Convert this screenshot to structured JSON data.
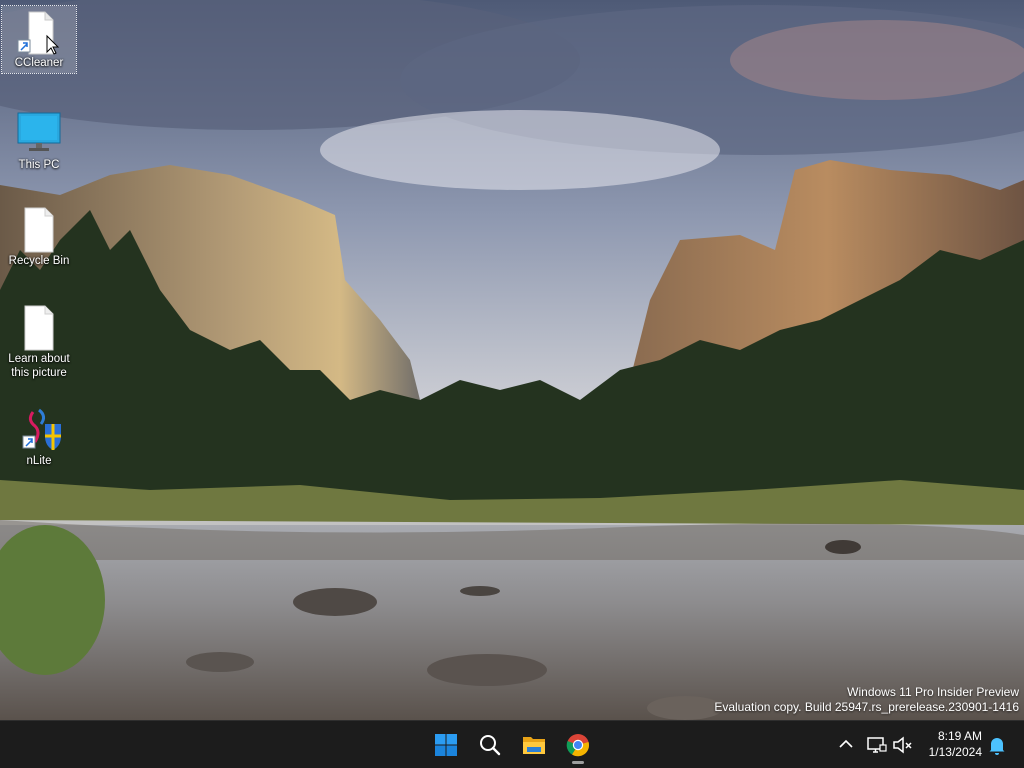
{
  "desktop": {
    "icons": [
      {
        "label": "CCleaner",
        "icon": "ccleaner-icon",
        "selected": true
      },
      {
        "label": "This PC",
        "icon": "monitor-icon"
      },
      {
        "label": "Recycle Bin",
        "icon": "recycle-bin-icon"
      },
      {
        "label": "Learn about this picture",
        "icon": "document-icon"
      },
      {
        "label": "nLite",
        "icon": "nlite-icon"
      }
    ],
    "watermark": {
      "line1": "Windows 11 Pro Insider Preview",
      "line2": "Evaluation copy. Build 25947.rs_prerelease.230901-1416"
    }
  },
  "taskbar": {
    "pinned": [
      {
        "name": "start-button",
        "icon": "windows-logo-icon"
      },
      {
        "name": "search-button",
        "icon": "search-icon"
      },
      {
        "name": "file-explorer-button",
        "icon": "folder-icon"
      },
      {
        "name": "chrome-button",
        "icon": "chrome-icon",
        "running": true
      }
    ],
    "tray": {
      "icons": [
        "chevron-up-icon",
        "network-icon",
        "volume-muted-icon",
        "notification-bell-icon"
      ],
      "time": "8:19 AM",
      "date": "1/13/2024"
    }
  },
  "colors": {
    "taskbar_bg": "#1c1c1c",
    "accent_blue": "#0078d4",
    "bell_blue": "#4cc2ff"
  }
}
